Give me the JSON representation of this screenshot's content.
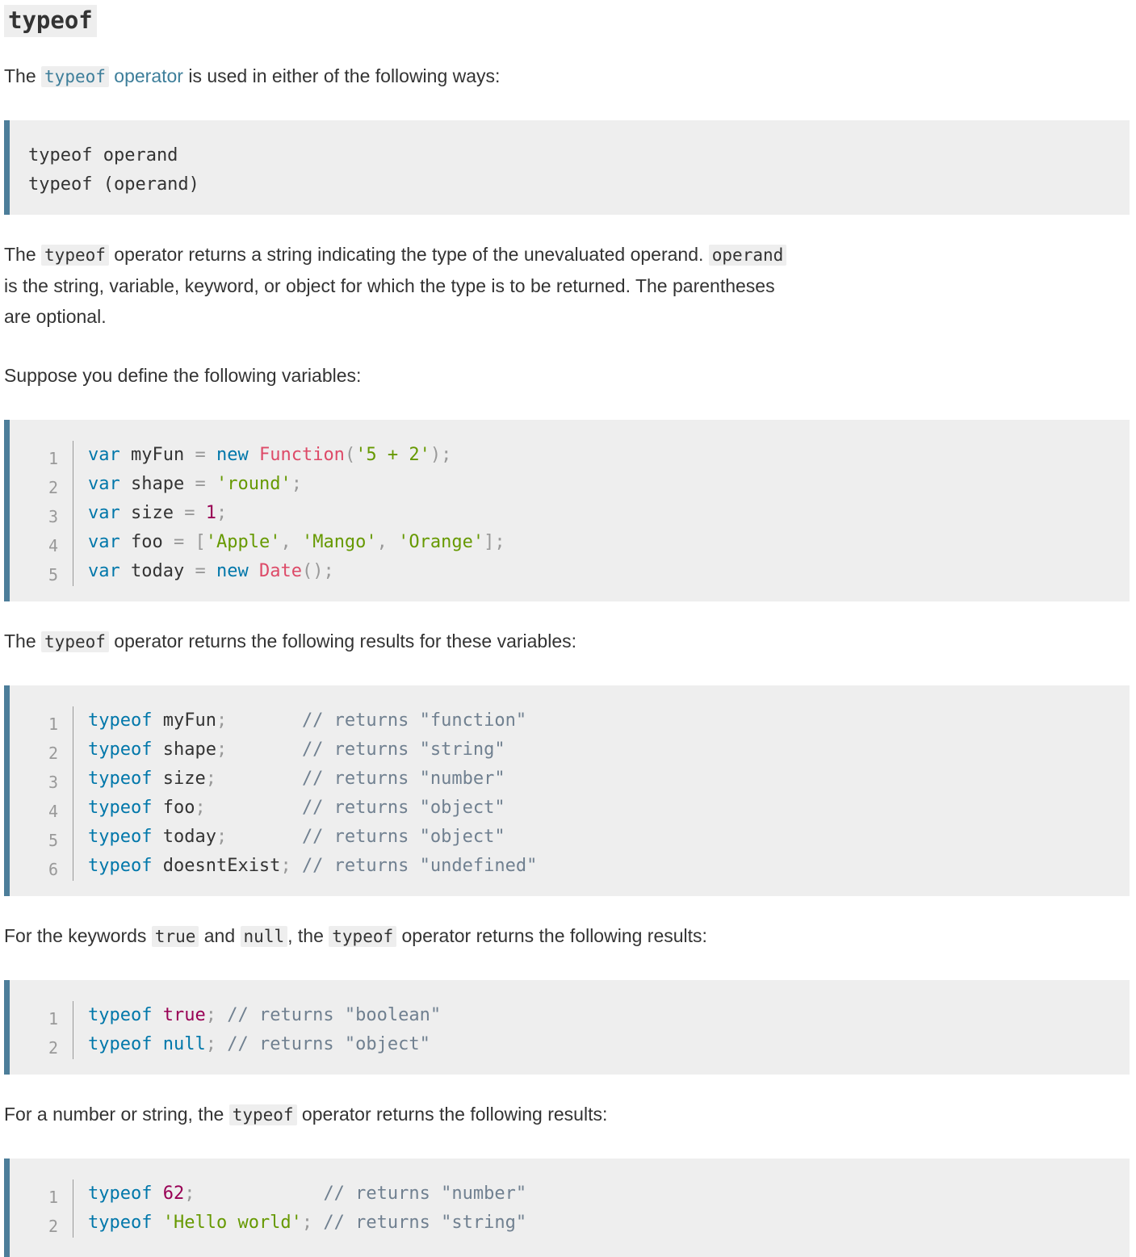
{
  "heading": "typeof",
  "intro": {
    "before": "The ",
    "link_code": "typeof",
    "link_text": " operator",
    "after": " is used in either of the following ways:"
  },
  "syntax_lines": [
    "typeof operand",
    "typeof (operand)"
  ],
  "para_desc": {
    "s1": "The ",
    "c1": "typeof",
    "s2": " operator returns a string indicating the type of the unevaluated operand. ",
    "c2": "operand",
    "s3": "is the string, variable, keyword, or object for which the type is to be returned. The parentheses",
    "s4": "are optional."
  },
  "para_suppose": "Suppose you define the following variables:",
  "code1": {
    "line_numbers": [
      "1",
      "2",
      "3",
      "4",
      "5"
    ],
    "l1": [
      "var",
      " myFun ",
      "=",
      " ",
      "new",
      " ",
      "Function",
      "(",
      "'5 + 2'",
      ");"
    ],
    "l2": [
      "var",
      " shape ",
      "=",
      " ",
      "'round'",
      ";"
    ],
    "l3": [
      "var",
      " size ",
      "=",
      " ",
      "1",
      ";"
    ],
    "l4": [
      "var",
      " foo ",
      "=",
      " ",
      "[",
      "'Apple'",
      ",",
      " ",
      "'Mango'",
      ",",
      " ",
      "'Orange'",
      "];"
    ],
    "l5": [
      "var",
      " today ",
      "=",
      " ",
      "new",
      " ",
      "Date",
      "();"
    ]
  },
  "para_results": {
    "s1": "The ",
    "c1": "typeof",
    "s2": " operator returns the following results for these variables:"
  },
  "code2": {
    "line_numbers": [
      "1",
      "2",
      "3",
      "4",
      "5",
      "6"
    ],
    "lines": [
      [
        "typeof",
        " myFun",
        ";",
        "       ",
        "// returns \"function\""
      ],
      [
        "typeof",
        " shape",
        ";",
        "       ",
        "// returns \"string\""
      ],
      [
        "typeof",
        " size",
        ";",
        "        ",
        "// returns \"number\""
      ],
      [
        "typeof",
        " foo",
        ";",
        "         ",
        "// returns \"object\""
      ],
      [
        "typeof",
        " today",
        ";",
        "       ",
        "// returns \"object\""
      ],
      [
        "typeof",
        " doesntExist",
        ";",
        " ",
        "// returns \"undefined\""
      ]
    ]
  },
  "para_keywords": {
    "s1": "For the keywords ",
    "c1": "true",
    "s2": " and ",
    "c2": "null",
    "s3": ", the ",
    "c3": "typeof",
    "s4": " operator returns the following results:"
  },
  "code3": {
    "line_numbers": [
      "1",
      "2"
    ],
    "lines": [
      [
        "typeof",
        " ",
        "true",
        ";",
        " ",
        "// returns \"boolean\""
      ],
      [
        "typeof",
        " ",
        "null",
        ";",
        " ",
        "// returns \"object\""
      ]
    ]
  },
  "para_number": {
    "s1": "For a number or string, the ",
    "c1": "typeof",
    "s2": " operator returns the following results:"
  },
  "code4": {
    "line_numbers": [
      "1",
      "2"
    ],
    "lines": [
      [
        "typeof",
        " ",
        "62",
        ";",
        "            ",
        "// returns \"number\""
      ],
      [
        "typeof",
        " ",
        "'Hello world'",
        ";",
        " ",
        "// returns \"string\""
      ]
    ]
  }
}
